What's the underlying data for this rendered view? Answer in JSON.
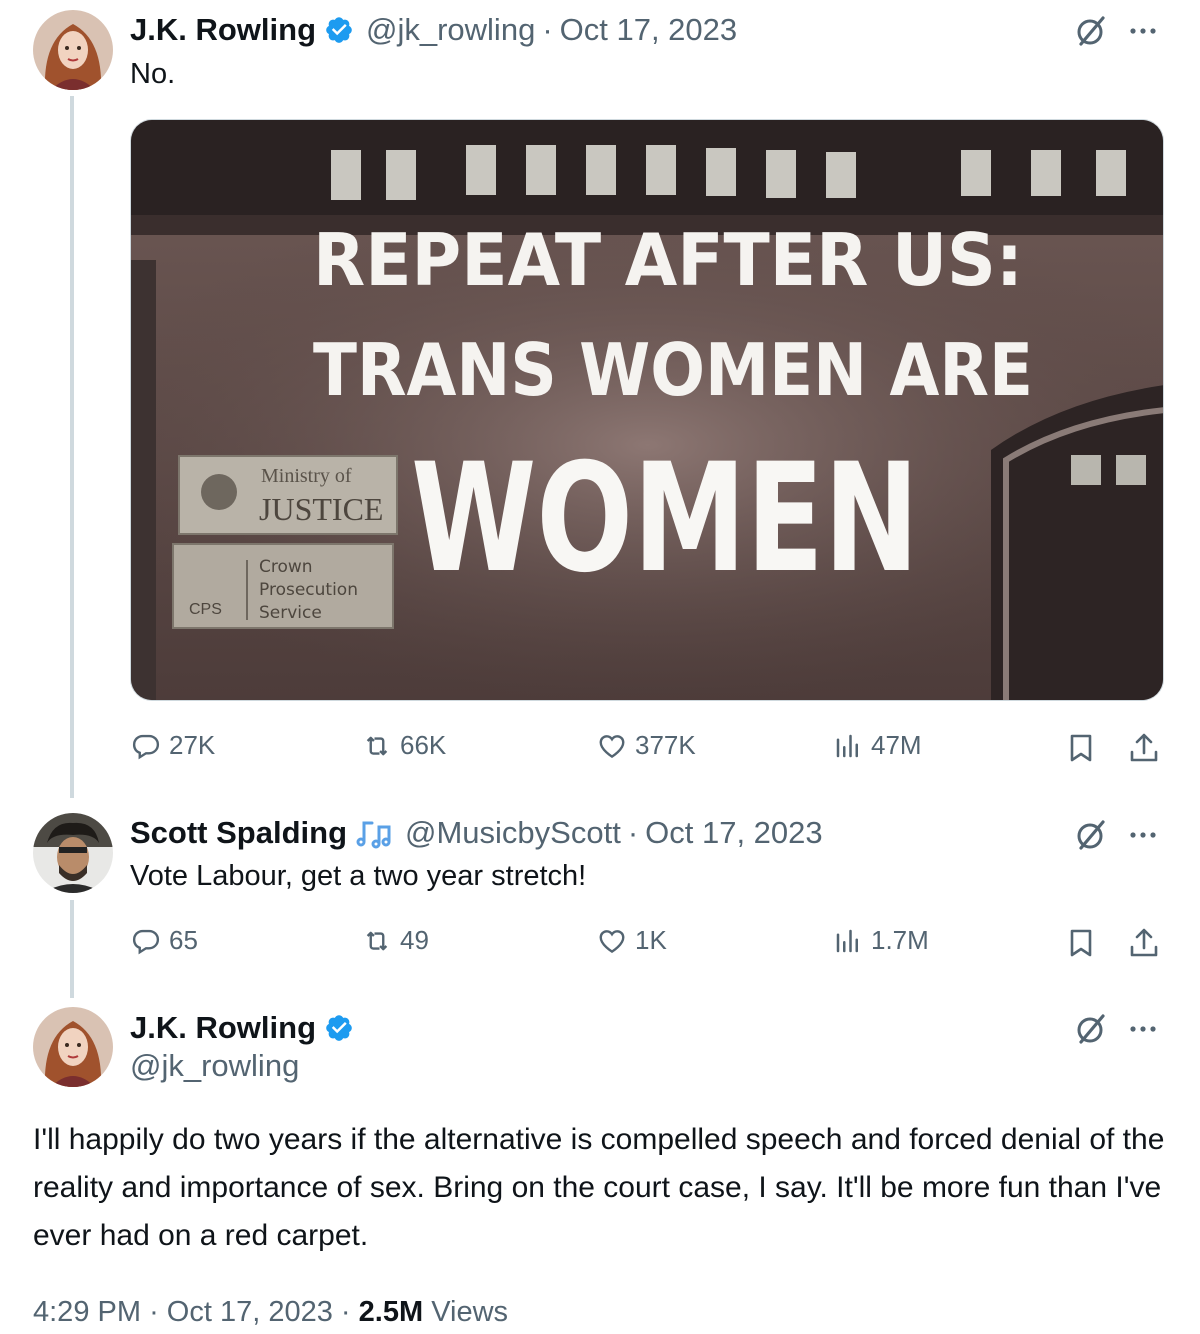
{
  "tweet1": {
    "name": "J.K. Rowling",
    "handle": "@jk_rowling",
    "sep": "·",
    "date": "Oct 17, 2023",
    "text": "No.",
    "image": {
      "line1": "REPEAT AFTER US:",
      "line2": "TRANS WOMEN ARE",
      "line3": "WOMEN",
      "sign_top_small": "Ministry of",
      "sign_top_big": "JUSTICE",
      "sign_bottom_abbr": "CPS",
      "sign_bottom_1": "Crown",
      "sign_bottom_2": "Prosecution",
      "sign_bottom_3": "Service"
    },
    "replies": "27K",
    "reposts": "66K",
    "likes": "377K",
    "views": "47M"
  },
  "tweet2": {
    "name": "Scott Spalding",
    "handle": "@MusicbyScott",
    "sep": "·",
    "date": "Oct 17, 2023",
    "text": "Vote Labour, get a two year stretch!",
    "replies": "65",
    "reposts": "49",
    "likes": "1K",
    "views": "1.7M"
  },
  "tweet3": {
    "name": "J.K. Rowling",
    "handle": "@jk_rowling",
    "text": "I'll happily do two years if the alternative is compelled speech and forced denial of the reality and importance of sex. Bring on the court case, I say. It'll be more fun than I've ever had on a red carpet.",
    "time": "4:29 PM",
    "sep": "·",
    "date": "Oct 17, 2023",
    "sep2": "·",
    "views_count": "2.5M",
    "views_label": "Views"
  },
  "icons": {
    "verified": "verified-badge-icon",
    "music_note": "music-note-icon",
    "grok": "grok-icon",
    "more": "more-icon",
    "reply": "reply-icon",
    "repost": "repost-icon",
    "like": "like-icon",
    "views": "views-icon",
    "bookmark": "bookmark-icon",
    "share": "share-icon"
  },
  "colors": {
    "verified": "#1d9bf0",
    "text_primary": "#0f1419",
    "text_secondary": "#536471",
    "thread_line": "#cfd9de"
  }
}
